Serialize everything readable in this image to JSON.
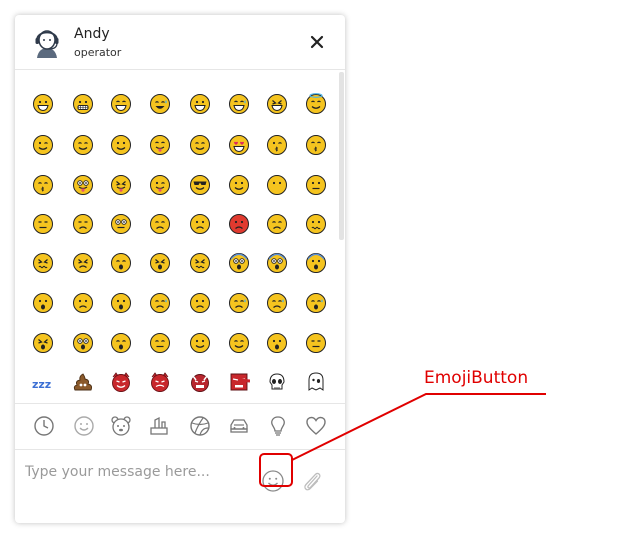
{
  "header": {
    "agent_name": "Andy",
    "agent_role": "operator",
    "close_icon": "close-icon"
  },
  "emoji_grid": {
    "rows": [
      [
        "grinning",
        "grimacing",
        "smile",
        "joy",
        "grin",
        "sweat-smile",
        "laughing",
        "innocent"
      ],
      [
        "wink",
        "blush",
        "slight-smile",
        "yum",
        "relieved",
        "heart-eyes",
        "kissing-heart",
        "kissing-smiling-eyes"
      ],
      [
        "kissing-closed-eyes",
        "stuck-out-tongue",
        "stuck-out-tongue-closed-eyes",
        "stuck-out-tongue-wink",
        "sunglasses",
        "smirk",
        "no-mouth",
        "neutral"
      ],
      [
        "expressionless",
        "unamused",
        "rolling-eyes",
        "pensive",
        "angry",
        "rage",
        "disappointed",
        "confused"
      ],
      [
        "confounded",
        "tired",
        "weary",
        "tired-face",
        "persevere",
        "scream",
        "fearful",
        "cold-sweat"
      ],
      [
        "hushed",
        "frowning",
        "anguished",
        "cry",
        "sad",
        "disappointed-relieved",
        "sweat",
        "sob"
      ],
      [
        "dizzy",
        "astonished",
        "sleeping",
        "sleepy",
        "hugging",
        "drooling",
        "thinking",
        "face-with-hand"
      ],
      [
        "zzz",
        "poop",
        "imp",
        "smiling-imp",
        "japanese-ogre",
        "japanese-goblin",
        "skull",
        "ghost"
      ]
    ],
    "accent": "#f5c41f",
    "outline": "#222222"
  },
  "categories": [
    {
      "name": "recent",
      "icon": "clock-icon"
    },
    {
      "name": "smileys",
      "icon": "smiley-icon"
    },
    {
      "name": "animals",
      "icon": "bear-icon"
    },
    {
      "name": "food",
      "icon": "food-icon"
    },
    {
      "name": "activity",
      "icon": "ball-icon"
    },
    {
      "name": "travel",
      "icon": "car-icon"
    },
    {
      "name": "objects",
      "icon": "lightbulb-icon"
    },
    {
      "name": "symbols",
      "icon": "heart-icon"
    }
  ],
  "input": {
    "placeholder": "Type your message here..."
  },
  "annotation": {
    "label": "EmojiButton",
    "color": "#e00000"
  }
}
